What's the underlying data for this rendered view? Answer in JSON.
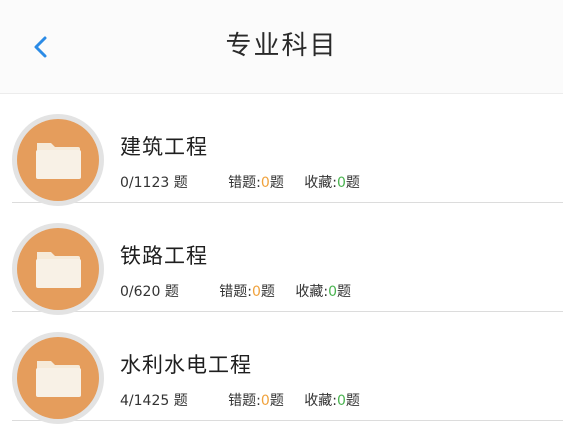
{
  "header": {
    "title": "专业科目",
    "back_icon": "chevron-left-icon",
    "accent_color": "#2b8be6"
  },
  "colors": {
    "avatar_bg": "#e59d5c",
    "avatar_ring": "#e3e3e3",
    "wrong_count_color": "#f0a23c",
    "fav_count_color": "#49b34f"
  },
  "subjects": [
    {
      "title": "建筑工程",
      "progress": "0/1123",
      "progress_suffix": "题",
      "wrong_label": "错题:",
      "wrong_count": "0",
      "wrong_suffix": "题",
      "fav_label": "收藏:",
      "fav_count": "0",
      "fav_suffix": "题",
      "icon": "folder-icon"
    },
    {
      "title": "铁路工程",
      "progress": "0/620",
      "progress_suffix": "题",
      "wrong_label": "错题:",
      "wrong_count": "0",
      "wrong_suffix": "题",
      "fav_label": "收藏:",
      "fav_count": "0",
      "fav_suffix": "题",
      "icon": "folder-icon"
    },
    {
      "title": "水利水电工程",
      "progress": "4/1425",
      "progress_suffix": "题",
      "wrong_label": "错题:",
      "wrong_count": "0",
      "wrong_suffix": "题",
      "fav_label": "收藏:",
      "fav_count": "0",
      "fav_suffix": "题",
      "icon": "folder-icon"
    }
  ]
}
